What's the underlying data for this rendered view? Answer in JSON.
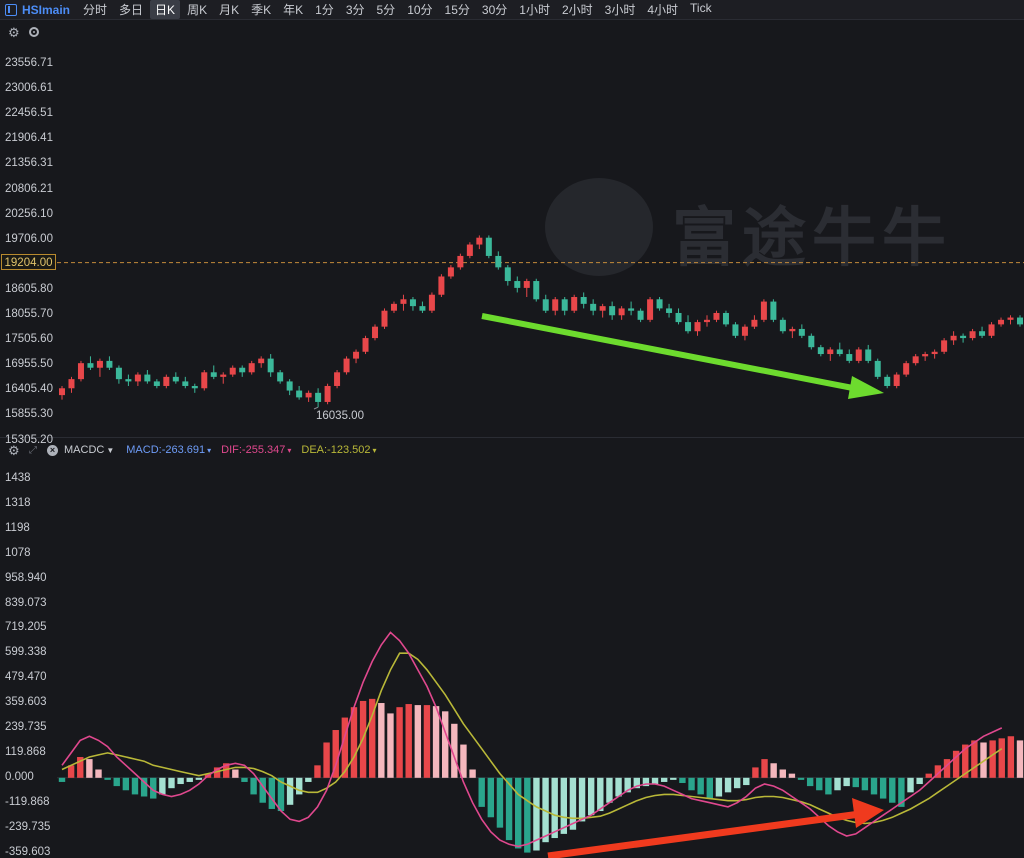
{
  "toolbar": {
    "symbol": "HSImain",
    "timeframes": [
      "分时",
      "多日",
      "日K",
      "周K",
      "月K",
      "季K",
      "年K",
      "1分",
      "3分",
      "5分",
      "10分",
      "15分",
      "30分",
      "1小时",
      "2小时",
      "3小时",
      "4小时",
      "Tick"
    ],
    "active": "日K"
  },
  "watermark": "富途牛牛",
  "price_axis": {
    "ticks": [
      "23556.71",
      "23006.61",
      "22456.51",
      "21906.41",
      "21356.31",
      "20806.21",
      "20256.10",
      "19706.00",
      "19204.00",
      "18605.80",
      "18055.70",
      "17505.60",
      "16955.50",
      "16405.40",
      "15855.30",
      "15305.20"
    ],
    "current_price": "19204.00",
    "low_label": "16035.00"
  },
  "indicator": {
    "name": "MACDC",
    "macd_label": "MACD:-263.691",
    "dif_label": "DIF:-255.347",
    "dea_label": "DEA:-123.502",
    "ticks": [
      "1438",
      "1318",
      "1198",
      "1078",
      "958.940",
      "839.073",
      "719.205",
      "599.338",
      "479.470",
      "359.603",
      "239.735",
      "119.868",
      "0.000",
      "-119.868",
      "-239.735",
      "-359.603"
    ]
  },
  "colors": {
    "up": "#e8474a",
    "down": "#3bb89a",
    "dif": "#e0488e",
    "dea": "#b9b838",
    "green_arrow": "#6ddb2e",
    "red_arrow": "#f03a1e"
  },
  "chart_data": [
    {
      "type": "candlestick",
      "title": "HSImain",
      "ylim": [
        15305.2,
        23556.71
      ],
      "ohlc": [
        [
          16300,
          16500,
          16200,
          16450
        ],
        [
          16450,
          16700,
          16350,
          16650
        ],
        [
          16650,
          17050,
          16600,
          17000
        ],
        [
          17000,
          17150,
          16850,
          16900
        ],
        [
          16900,
          17100,
          16700,
          17050
        ],
        [
          17050,
          17150,
          16850,
          16900
        ],
        [
          16900,
          16950,
          16550,
          16650
        ],
        [
          16650,
          16750,
          16500,
          16600
        ],
        [
          16600,
          16800,
          16500,
          16750
        ],
        [
          16750,
          16850,
          16550,
          16600
        ],
        [
          16600,
          16650,
          16450,
          16500
        ],
        [
          16500,
          16750,
          16450,
          16700
        ],
        [
          16700,
          16800,
          16550,
          16600
        ],
        [
          16600,
          16700,
          16450,
          16500
        ],
        [
          16500,
          16550,
          16350,
          16450
        ],
        [
          16450,
          16850,
          16400,
          16800
        ],
        [
          16800,
          16950,
          16650,
          16700
        ],
        [
          16700,
          16800,
          16550,
          16750
        ],
        [
          16750,
          16950,
          16700,
          16900
        ],
        [
          16900,
          16950,
          16700,
          16800
        ],
        [
          16800,
          17050,
          16750,
          17000
        ],
        [
          17000,
          17150,
          16900,
          17100
        ],
        [
          17100,
          17200,
          16700,
          16800
        ],
        [
          16800,
          16850,
          16550,
          16600
        ],
        [
          16600,
          16650,
          16300,
          16400
        ],
        [
          16400,
          16500,
          16200,
          16250
        ],
        [
          16250,
          16400,
          16150,
          16350
        ],
        [
          16350,
          16450,
          16035,
          16150
        ],
        [
          16150,
          16550,
          16100,
          16500
        ],
        [
          16500,
          16850,
          16450,
          16800
        ],
        [
          16800,
          17150,
          16750,
          17100
        ],
        [
          17100,
          17300,
          17000,
          17250
        ],
        [
          17250,
          17600,
          17200,
          17550
        ],
        [
          17550,
          17850,
          17500,
          17800
        ],
        [
          17800,
          18200,
          17750,
          18150
        ],
        [
          18150,
          18350,
          18100,
          18300
        ],
        [
          18300,
          18500,
          18150,
          18400
        ],
        [
          18400,
          18450,
          18150,
          18250
        ],
        [
          18250,
          18350,
          18100,
          18150
        ],
        [
          18150,
          18550,
          18100,
          18500
        ],
        [
          18500,
          18950,
          18450,
          18900
        ],
        [
          18900,
          19150,
          18850,
          19100
        ],
        [
          19100,
          19400,
          19050,
          19350
        ],
        [
          19350,
          19650,
          19300,
          19600
        ],
        [
          19600,
          19800,
          19500,
          19750
        ],
        [
          19750,
          19800,
          19300,
          19350
        ],
        [
          19350,
          19450,
          19050,
          19100
        ],
        [
          19100,
          19150,
          18700,
          18800
        ],
        [
          18800,
          18900,
          18550,
          18650
        ],
        [
          18650,
          18850,
          18450,
          18800
        ],
        [
          18800,
          18850,
          18350,
          18400
        ],
        [
          18400,
          18500,
          18100,
          18150
        ],
        [
          18150,
          18450,
          18050,
          18400
        ],
        [
          18400,
          18450,
          18050,
          18150
        ],
        [
          18150,
          18500,
          18100,
          18450
        ],
        [
          18450,
          18550,
          18200,
          18300
        ],
        [
          18300,
          18400,
          18050,
          18150
        ],
        [
          18150,
          18300,
          18000,
          18250
        ],
        [
          18250,
          18350,
          17950,
          18050
        ],
        [
          18050,
          18250,
          17950,
          18200
        ],
        [
          18200,
          18350,
          18050,
          18150
        ],
        [
          18150,
          18200,
          17900,
          17950
        ],
        [
          17950,
          18450,
          17900,
          18400
        ],
        [
          18400,
          18450,
          18150,
          18200
        ],
        [
          18200,
          18300,
          18000,
          18100
        ],
        [
          18100,
          18200,
          17850,
          17900
        ],
        [
          17900,
          18050,
          17650,
          17700
        ],
        [
          17700,
          17950,
          17600,
          17900
        ],
        [
          17900,
          18050,
          17800,
          17950
        ],
        [
          17950,
          18150,
          17900,
          18100
        ],
        [
          18100,
          18150,
          17800,
          17850
        ],
        [
          17850,
          17900,
          17550,
          17600
        ],
        [
          17600,
          17850,
          17500,
          17800
        ],
        [
          17800,
          18050,
          17750,
          17950
        ],
        [
          17950,
          18400,
          17900,
          18350
        ],
        [
          18350,
          18400,
          17900,
          17950
        ],
        [
          17950,
          18000,
          17650,
          17700
        ],
        [
          17700,
          17800,
          17550,
          17750
        ],
        [
          17750,
          17850,
          17550,
          17600
        ],
        [
          17600,
          17650,
          17300,
          17350
        ],
        [
          17350,
          17400,
          17150,
          17200
        ],
        [
          17200,
          17350,
          17050,
          17300
        ],
        [
          17300,
          17450,
          17150,
          17200
        ],
        [
          17200,
          17300,
          17000,
          17050
        ],
        [
          17050,
          17350,
          17000,
          17300
        ],
        [
          17300,
          17400,
          17000,
          17050
        ],
        [
          17050,
          17100,
          16650,
          16700
        ],
        [
          16700,
          16750,
          16450,
          16500
        ],
        [
          16500,
          16800,
          16450,
          16750
        ],
        [
          16750,
          17050,
          16700,
          17000
        ],
        [
          17000,
          17200,
          16950,
          17150
        ],
        [
          17150,
          17250,
          17050,
          17200
        ],
        [
          17200,
          17300,
          17100,
          17250
        ],
        [
          17250,
          17550,
          17200,
          17500
        ],
        [
          17500,
          17700,
          17400,
          17600
        ],
        [
          17600,
          17650,
          17450,
          17550
        ],
        [
          17550,
          17750,
          17500,
          17700
        ],
        [
          17700,
          17800,
          17550,
          17600
        ],
        [
          17600,
          17900,
          17550,
          17850
        ],
        [
          17850,
          18000,
          17800,
          17950
        ],
        [
          17950,
          18050,
          17850,
          18000
        ],
        [
          18000,
          18050,
          17800,
          17850
        ]
      ]
    },
    {
      "type": "bar",
      "title": "MACDC",
      "ylim": [
        -359.603,
        1438
      ],
      "macd_hist": [
        -20,
        60,
        100,
        90,
        40,
        -10,
        -40,
        -60,
        -80,
        -90,
        -100,
        -80,
        -50,
        -30,
        -20,
        -10,
        20,
        50,
        70,
        40,
        -20,
        -80,
        -120,
        -150,
        -160,
        -130,
        -80,
        -20,
        60,
        170,
        230,
        290,
        340,
        370,
        380,
        360,
        310,
        340,
        355,
        350,
        350,
        345,
        320,
        260,
        160,
        40,
        -140,
        -190,
        -240,
        -300,
        -340,
        -360,
        -350,
        -310,
        -290,
        -270,
        -250,
        -210,
        -180,
        -160,
        -120,
        -90,
        -70,
        -50,
        -40,
        -30,
        -20,
        -10,
        -25,
        -60,
        -80,
        -100,
        -90,
        -70,
        -50,
        -35,
        50,
        90,
        70,
        40,
        20,
        -10,
        -40,
        -60,
        -80,
        -60,
        -40,
        -45,
        -60,
        -80,
        -100,
        -120,
        -140,
        -70,
        -30,
        20,
        60,
        90,
        130,
        160,
        180,
        170,
        180,
        190,
        200,
        180
      ],
      "dif": [
        60,
        120,
        180,
        200,
        180,
        150,
        100,
        60,
        20,
        -20,
        -60,
        -80,
        -90,
        -80,
        -60,
        -30,
        10,
        40,
        60,
        70,
        60,
        20,
        -40,
        -100,
        -160,
        -200,
        -210,
        -190,
        -140,
        -60,
        60,
        200,
        340,
        460,
        560,
        640,
        700,
        660,
        600,
        520,
        440,
        340,
        220,
        100,
        -20,
        -120,
        -200,
        -260,
        -300,
        -320,
        -330,
        -320,
        -300,
        -280,
        -260,
        -240,
        -220,
        -200,
        -180,
        -150,
        -120,
        -90,
        -60,
        -40,
        -30,
        -30,
        -40,
        -60,
        -80,
        -100,
        -110,
        -120,
        -130,
        -140,
        -120,
        -90,
        -50,
        -30,
        -40,
        -60,
        -90,
        -120,
        -150,
        -190,
        -230,
        -260,
        -280,
        -270,
        -240,
        -210,
        -180,
        -150,
        -120,
        -90,
        -60,
        -20,
        20,
        60,
        100,
        140,
        170,
        200,
        220,
        240
      ],
      "dea": [
        40,
        60,
        80,
        100,
        110,
        120,
        110,
        100,
        90,
        80,
        60,
        50,
        40,
        30,
        20,
        10,
        20,
        30,
        40,
        50,
        50,
        45,
        30,
        10,
        -20,
        -40,
        -60,
        -70,
        -70,
        -50,
        -20,
        30,
        100,
        190,
        300,
        420,
        520,
        600,
        600,
        570,
        520,
        460,
        400,
        330,
        260,
        200,
        140,
        80,
        20,
        -30,
        -80,
        -110,
        -140,
        -160,
        -180,
        -190,
        -195,
        -195,
        -190,
        -185,
        -170,
        -150,
        -130,
        -110,
        -95,
        -85,
        -80,
        -80,
        -85,
        -90,
        -95,
        -100,
        -105,
        -110,
        -110,
        -105,
        -95,
        -90,
        -90,
        -95,
        -105,
        -115,
        -130,
        -150,
        -170,
        -190,
        -205,
        -215,
        -220,
        -215,
        -205,
        -190,
        -170,
        -150,
        -125,
        -100,
        -70,
        -40,
        -10,
        20,
        50,
        80,
        110,
        140
      ]
    }
  ]
}
